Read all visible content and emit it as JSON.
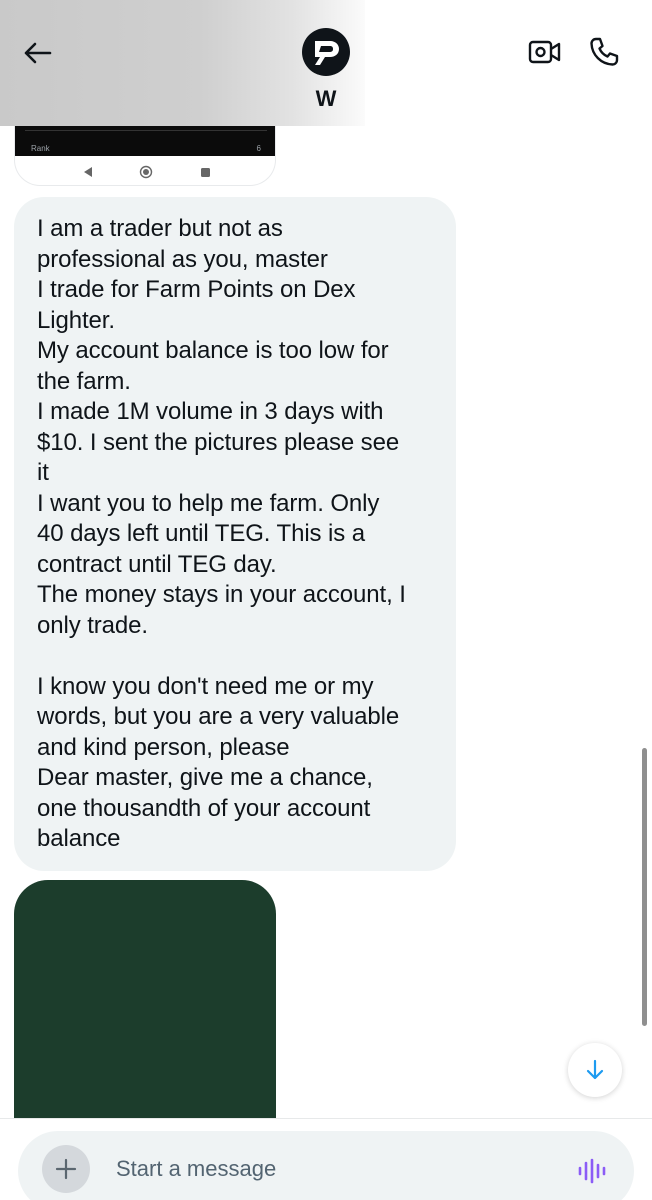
{
  "header": {
    "contact_name": "W",
    "avatar_icon": "pointer-logo-icon",
    "back_icon": "arrow-left-icon",
    "video_icon": "video-camera-icon",
    "call_icon": "phone-icon"
  },
  "messages": {
    "top_attachment": {
      "rank_label": "Rank",
      "rank_value": "6"
    },
    "text_bubble": "I am a trader but not as\nprofessional as you, master\nI trade for Farm Points on Dex\nLighter.\nMy account balance is too low for\nthe farm.\nI made 1M volume in 3 days with\n$10. I sent the pictures please see\nit\nI want you to help me farm. Only\n40 days left until TEG. This is a\ncontract until TEG day.\nThe money stays in your account, I\nonly trade.\n\nI know you don't need me or my\nwords, but you are a very valuable\nand kind person, please\nDear master, give me a chance,\none thousandth of your account\nbalance",
    "bottom_attachment_color": "#1c3d2c"
  },
  "composer": {
    "placeholder": "Start a message",
    "add_icon": "plus-icon",
    "voice_icon": "voice-waveform-icon"
  },
  "colors": {
    "bubble": "#eff3f4",
    "accent": "#1d9bf0",
    "voice": "#8b5cf6"
  }
}
